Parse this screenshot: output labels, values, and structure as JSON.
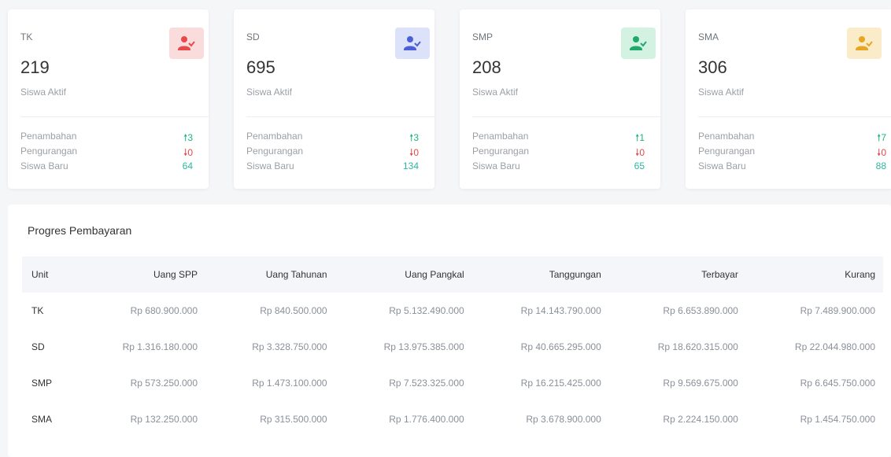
{
  "cards": [
    {
      "unit": "TK",
      "count": "219",
      "subtitle": "Siswa Aktif",
      "icon": "user-check-icon",
      "color": "#e84a4a",
      "bg": "#fbdcdc",
      "penambahan_label": "Penambahan",
      "penambahan": "3",
      "pengurangan_label": "Pengurangan",
      "pengurangan": "0",
      "baru_label": "Siswa Baru",
      "baru": "64"
    },
    {
      "unit": "SD",
      "count": "695",
      "subtitle": "Siswa Aktif",
      "icon": "user-check-icon",
      "color": "#4a5fd8",
      "bg": "#dde2fb",
      "penambahan_label": "Penambahan",
      "penambahan": "3",
      "pengurangan_label": "Pengurangan",
      "pengurangan": "0",
      "baru_label": "Siswa Baru",
      "baru": "134"
    },
    {
      "unit": "SMP",
      "count": "208",
      "subtitle": "Siswa Aktif",
      "icon": "user-check-icon",
      "color": "#22a86b",
      "bg": "#d3f2e2",
      "penambahan_label": "Penambahan",
      "penambahan": "1",
      "pengurangan_label": "Pengurangan",
      "pengurangan": "0",
      "baru_label": "Siswa Baru",
      "baru": "65"
    },
    {
      "unit": "SMA",
      "count": "306",
      "subtitle": "Siswa Aktif",
      "icon": "user-check-icon",
      "color": "#e6a623",
      "bg": "#fbecc9",
      "penambahan_label": "Penambahan",
      "penambahan": "7",
      "pengurangan_label": "Pengurangan",
      "pengurangan": "0",
      "baru_label": "Siswa Baru",
      "baru": "88"
    }
  ],
  "progress": {
    "title": "Progres Pembayaran",
    "headers": [
      "Unit",
      "Uang SPP",
      "Uang Tahunan",
      "Uang Pangkal",
      "Tanggungan",
      "Terbayar",
      "Kurang"
    ],
    "rows": [
      [
        "TK",
        "Rp 680.900.000",
        "Rp 840.500.000",
        "Rp 5.132.490.000",
        "Rp 14.143.790.000",
        "Rp 6.653.890.000",
        "Rp 7.489.900.000"
      ],
      [
        "SD",
        "Rp 1.316.180.000",
        "Rp 3.328.750.000",
        "Rp 13.975.385.000",
        "Rp 40.665.295.000",
        "Rp 18.620.315.000",
        "Rp 22.044.980.000"
      ],
      [
        "SMP",
        "Rp 573.250.000",
        "Rp 1.473.100.000",
        "Rp 7.523.325.000",
        "Rp 16.215.425.000",
        "Rp 9.569.675.000",
        "Rp 6.645.750.000"
      ],
      [
        "SMA",
        "Rp 132.250.000",
        "Rp 315.500.000",
        "Rp 1.776.400.000",
        "Rp 3.678.900.000",
        "Rp 2.224.150.000",
        "Rp 1.454.750.000"
      ]
    ]
  }
}
